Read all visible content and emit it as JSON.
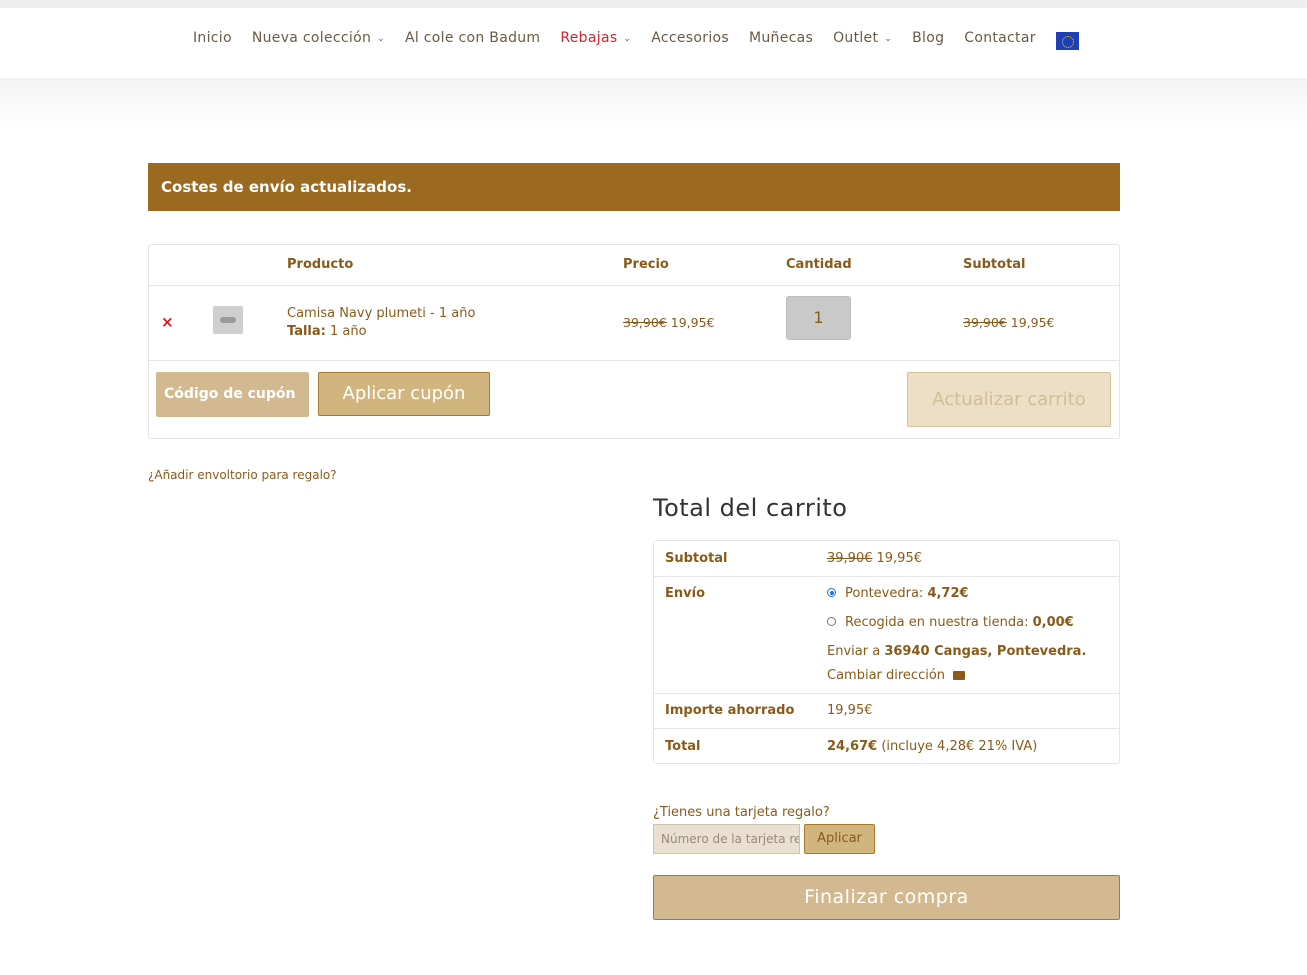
{
  "nav": {
    "items": [
      {
        "label": "Inicio",
        "has_dropdown": false,
        "active": false
      },
      {
        "label": "Nueva colección",
        "has_dropdown": true,
        "active": false
      },
      {
        "label": "Al cole con Badum",
        "has_dropdown": false,
        "active": false
      },
      {
        "label": "Rebajas",
        "has_dropdown": true,
        "active": true
      },
      {
        "label": "Accesorios",
        "has_dropdown": false,
        "active": false
      },
      {
        "label": "Muñecas",
        "has_dropdown": false,
        "active": false
      },
      {
        "label": "Outlet",
        "has_dropdown": true,
        "active": false
      },
      {
        "label": "Blog",
        "has_dropdown": false,
        "active": false
      },
      {
        "label": "Contactar",
        "has_dropdown": false,
        "active": false
      }
    ],
    "flag_icon": "eu-flag-icon"
  },
  "notice": {
    "text": "Costes de envío actualizados."
  },
  "cart": {
    "headers": {
      "product": "Producto",
      "price": "Precio",
      "quantity": "Cantidad",
      "subtotal": "Subtotal"
    },
    "item": {
      "remove": "×",
      "name": "Camisa Navy plumeti - 1 año",
      "meta_label": "Talla:",
      "meta_value": "1 año",
      "price_old": "39,90€",
      "price_new": "19,95€",
      "quantity": "1",
      "subtotal_old": "39,90€",
      "subtotal_new": "19,95€"
    },
    "coupon_placeholder": "Código de cupón",
    "apply_coupon": "Aplicar cupón",
    "update_cart": "Actualizar carrito"
  },
  "gift_wrap": "¿Añadir envoltorio para regalo?",
  "totals": {
    "title": "Total del carrito",
    "subtotal_label": "Subtotal",
    "subtotal_old": "39,90€",
    "subtotal_new": "19,95€",
    "shipping_label": "Envío",
    "shipping_option1_name": "Pontevedra:",
    "shipping_option1_price": "4,72€",
    "shipping_option2_name": "Recogida en nuestra tienda:",
    "shipping_option2_price": "0,00€",
    "ship_to_prefix": "Enviar a",
    "ship_to_address": "36940 Cangas, Pontevedra.",
    "change_address": "Cambiar dirección",
    "saved_label": "Importe ahorrado",
    "saved_value": "19,95€",
    "total_label": "Total",
    "total_value": "24,67€",
    "total_tax_note": "(incluye 4,28€ 21% IVA)"
  },
  "gift_card": {
    "question": "¿Tienes una tarjeta regalo?",
    "placeholder": "Número de la tarjeta regalo",
    "apply": "Aplicar"
  },
  "checkout": "Finalizar compra",
  "colors": {
    "brand": "#9b6a20",
    "text": "#8a5a1a",
    "active_nav": "#d0242c",
    "button": "#d1b57e"
  }
}
